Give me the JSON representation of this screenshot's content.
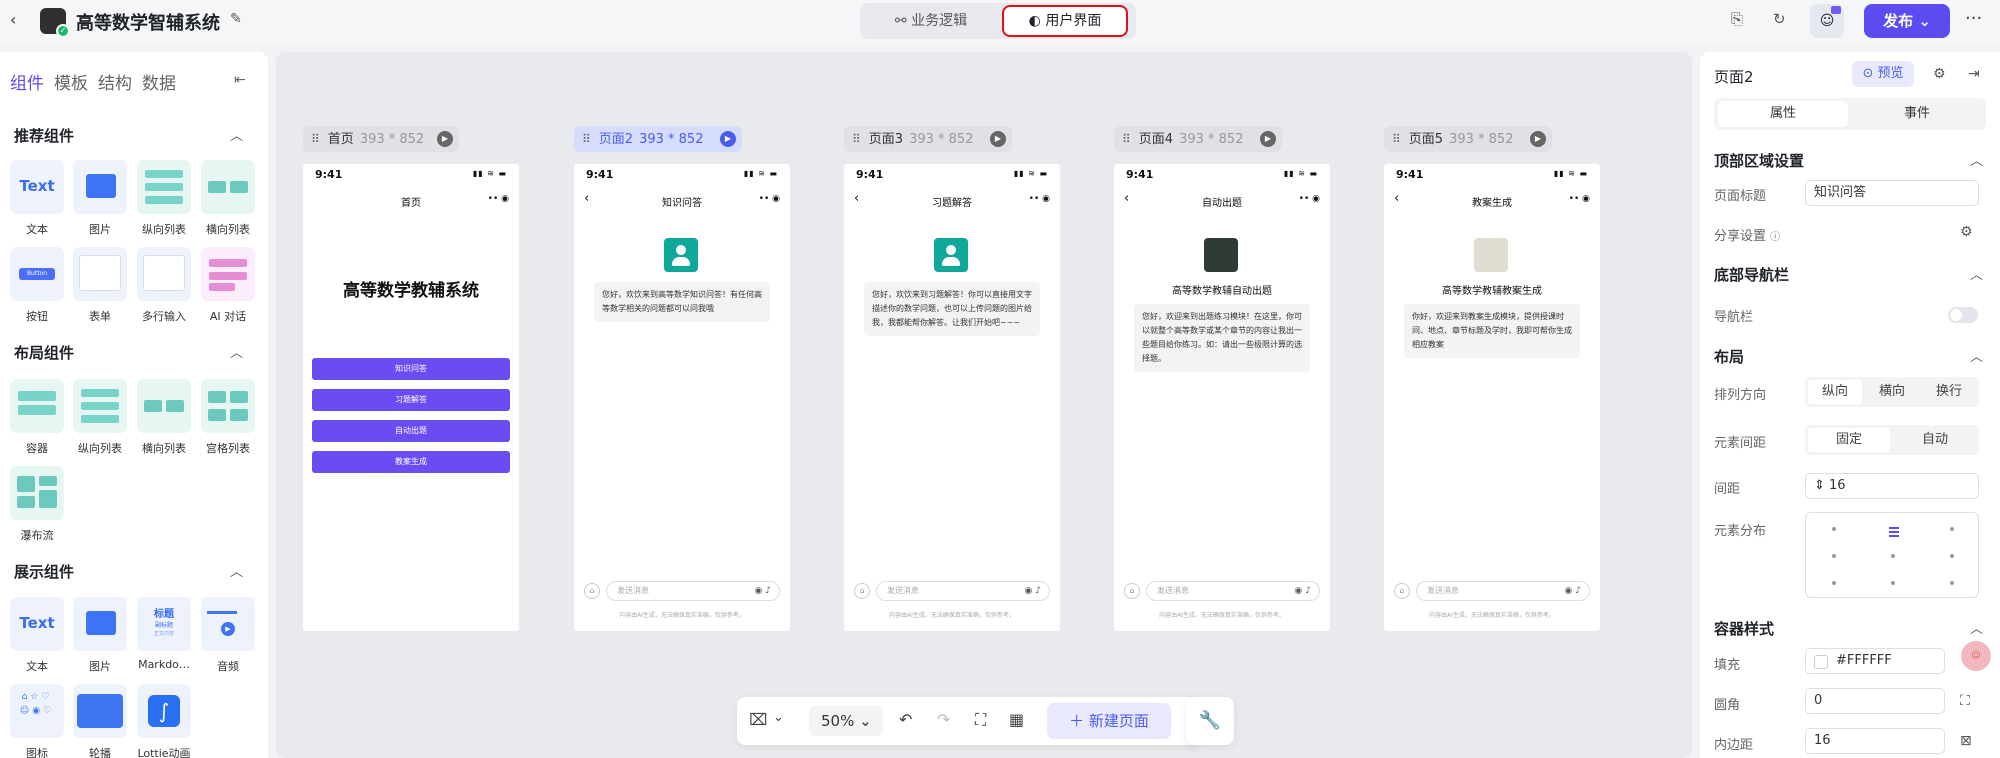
{
  "header": {
    "app_title": "高等数学智辅系统",
    "tabs": [
      {
        "label": "业务逻辑"
      },
      {
        "label": "用户界面"
      }
    ],
    "publish_label": "发布"
  },
  "left_panel": {
    "tabs": [
      "组件",
      "模板",
      "结构",
      "数据"
    ],
    "sections": [
      {
        "title": "推荐组件",
        "items": [
          "文本",
          "图片",
          "纵向列表",
          "横向列表",
          "按钮",
          "表单",
          "多行输入",
          "AI 对话"
        ]
      },
      {
        "title": "布局组件",
        "items": [
          "容器",
          "纵向列表",
          "横向列表",
          "宫格列表",
          "瀑布流"
        ]
      },
      {
        "title": "展示组件",
        "items": [
          "文本",
          "图片",
          "Markdo…",
          "音频",
          "图标",
          "轮播",
          "Lottie动画"
        ]
      }
    ],
    "thumb_text": {
      "text": "Text",
      "button": "Button",
      "md1": "标题",
      "md2": "副标题",
      "md3": "正文内容"
    }
  },
  "canvas": {
    "pages": [
      {
        "name": "首页",
        "size": "393 * 852"
      },
      {
        "name": "页面2",
        "size": "393 * 852"
      },
      {
        "name": "页面3",
        "size": "393 * 852"
      },
      {
        "name": "页面4",
        "size": "393 * 852"
      },
      {
        "name": "页面5",
        "size": "393 * 852"
      }
    ],
    "phone_time": "9:41",
    "home": {
      "nav_title": "首页",
      "heading": "高等数学教辅系统",
      "buttons": [
        "知识问答",
        "习题解答",
        "自动出题",
        "教案生成"
      ]
    },
    "page2": {
      "nav_title": "知识问答",
      "message": "您好，欢饮来到高等数学知识问答！有任何高等数学相关的问题都可以问我哦"
    },
    "page3": {
      "nav_title": "习题解答",
      "message": "您好，欢饮来到习题解答！你可以直接用文字描述你的数学问题，也可以上传问题的图片给我，我都能帮你解答。让我们开始吧~~~"
    },
    "page4": {
      "nav_title": "自动出题",
      "heading": "高等数学教辅自动出题",
      "message": "您好，欢迎来到出题练习模块！在这里，你可以就整个高等数学或某个章节的内容让我出一些题目给你练习。如：请出一些极限计算的选择题。"
    },
    "page5": {
      "nav_title": "教案生成",
      "heading": "高等数学教辅教案生成",
      "message": "你好，欢迎来到教案生成模块，提供授课时间、地点、章节标题及学时，我即可帮你生成相应教案"
    },
    "input_placeholder": "发送消息",
    "disclaimer": "内容由AI生成，无法确保真实准确，仅供参考。"
  },
  "bottom_bar": {
    "zoom": "50%",
    "new_page_label": "新建页面"
  },
  "right_panel": {
    "title": "页面2",
    "preview_label": "预览",
    "tabs": [
      "属性",
      "事件"
    ],
    "sections": {
      "top": "顶部区域设置",
      "bottom_nav": "底部导航栏",
      "layout": "布局",
      "container": "容器样式"
    },
    "labels": {
      "page_title": "页面标题",
      "share": "分享设置",
      "nav": "导航栏",
      "direction": "排列方向",
      "spacing_mode": "元素间距",
      "gap": "间距",
      "distribution": "元素分布",
      "fill": "填充",
      "radius": "圆角",
      "padding": "内边距"
    },
    "values": {
      "page_title": "知识问答",
      "direction_options": [
        "纵向",
        "横向",
        "换行"
      ],
      "spacing_options": [
        "固定",
        "自动"
      ],
      "gap": "16",
      "fill": "#FFFFFF",
      "radius": "0",
      "padding": "16"
    }
  },
  "colors": {
    "accent": "#5b4cf0",
    "phone_button": "#6a4cf2",
    "avatar": "#10a89a",
    "highlight": "#e0101a"
  }
}
